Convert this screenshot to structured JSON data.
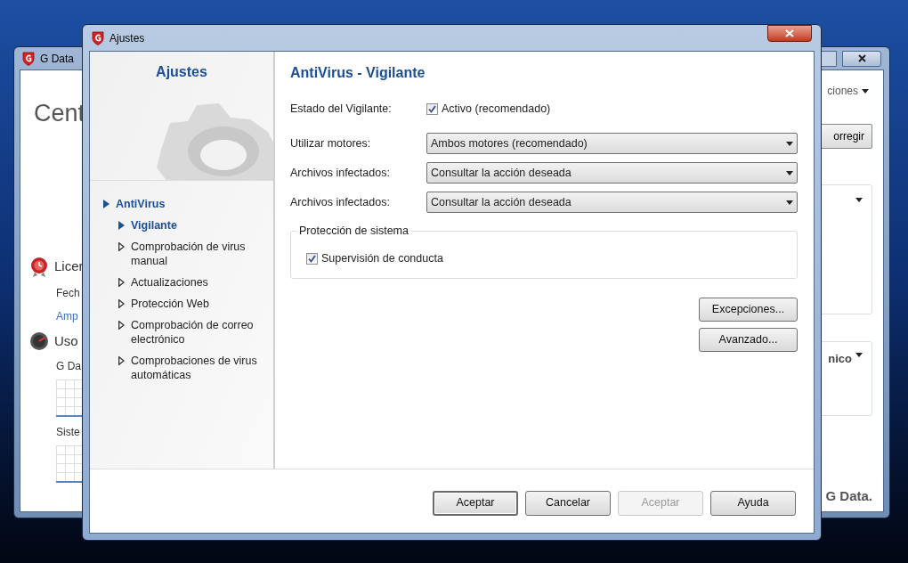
{
  "background_window": {
    "title": "G Data",
    "heading": "Cent",
    "menu": "ciones",
    "fix_button": "orregir",
    "panel_dropdown": "nico",
    "brand": "G Data.",
    "sections": [
      {
        "kind": "license",
        "title": "Licer",
        "lines": [
          {
            "text": "Fech",
            "link": false
          },
          {
            "text": "Amp",
            "link": true
          }
        ]
      },
      {
        "kind": "usage",
        "title": "Uso",
        "graphs": [
          {
            "label": "G Da"
          },
          {
            "label": "Siste"
          }
        ]
      }
    ]
  },
  "dialog": {
    "title": "Ajustes",
    "sidebar": {
      "title": "Ajustes",
      "tree": [
        {
          "label": "AntiVirus",
          "selected": true,
          "children": [
            {
              "label": "Vigilante",
              "selected": true
            },
            {
              "label": "Comprobación de virus manual",
              "selected": false
            },
            {
              "label": "Actualizaciones",
              "selected": false
            },
            {
              "label": "Protección Web",
              "selected": false
            },
            {
              "label": "Comprobación de correo electrónico",
              "selected": false
            },
            {
              "label": "Comprobaciones de virus automáticas",
              "selected": false
            }
          ]
        }
      ]
    },
    "main": {
      "title": "AntiVirus - Vigilante",
      "fields": [
        {
          "kind": "checkbox",
          "label": "Estado del Vigilante:",
          "text": "Activo (recomendado)",
          "checked": true
        },
        {
          "kind": "dropdown",
          "label": "Utilizar motores:",
          "value": "Ambos motores (recomendado)"
        },
        {
          "kind": "dropdown",
          "label": "Archivos infectados:",
          "value": "Consultar la acción deseada"
        },
        {
          "kind": "dropdown",
          "label": "Archivos infectados:",
          "value": "Consultar la acción deseada"
        }
      ],
      "group": {
        "title": "Protección de sistema",
        "checkbox": {
          "label": "Supervisión de conducta",
          "checked": true
        }
      },
      "side_buttons": [
        {
          "label": "Excepciones..."
        },
        {
          "label": "Avanzado..."
        }
      ]
    },
    "footer_buttons": [
      {
        "label": "Aceptar",
        "disabled": false,
        "default": true
      },
      {
        "label": "Cancelar",
        "disabled": false,
        "default": false
      },
      {
        "label": "Aceptar",
        "disabled": true,
        "default": false
      },
      {
        "label": "Ayuda",
        "disabled": false,
        "default": false
      }
    ]
  }
}
